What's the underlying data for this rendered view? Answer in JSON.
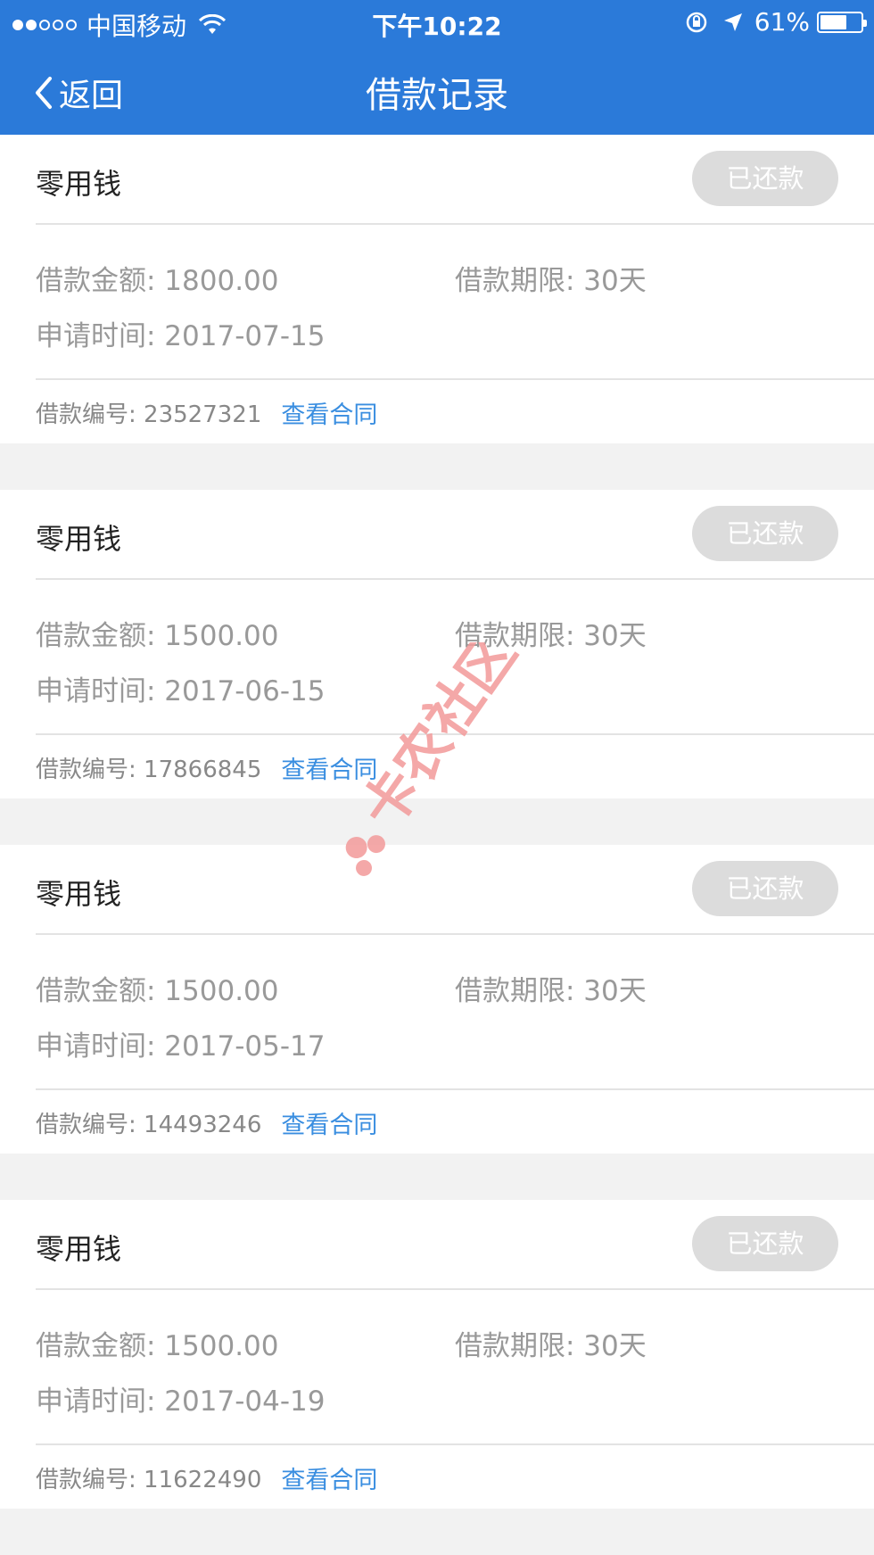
{
  "status_bar": {
    "carrier": "中国移动",
    "time": "下午10:22",
    "battery": "61%",
    "battery_level": 0.61,
    "signal_bars": 2
  },
  "nav": {
    "back_label": "返回",
    "title": "借款记录"
  },
  "colors": {
    "header": "#2b7ad9",
    "link": "#3a8ee0",
    "badge": "#dcdcdc"
  },
  "watermark": "卡农社区",
  "loans": [
    {
      "name": "零用钱",
      "status": "已还款",
      "amount": "借款金额: 1800.00",
      "term": "借款期限: 30天",
      "apply_time": "申请时间: 2017-07-15",
      "number": "借款编号: 23527321",
      "contract_link": "查看合同"
    },
    {
      "name": "零用钱",
      "status": "已还款",
      "amount": "借款金额: 1500.00",
      "term": "借款期限: 30天",
      "apply_time": "申请时间: 2017-06-15",
      "number": "借款编号: 17866845",
      "contract_link": "查看合同"
    },
    {
      "name": "零用钱",
      "status": "已还款",
      "amount": "借款金额: 1500.00",
      "term": "借款期限: 30天",
      "apply_time": "申请时间: 2017-05-17",
      "number": "借款编号: 14493246",
      "contract_link": "查看合同"
    },
    {
      "name": "零用钱",
      "status": "已还款",
      "amount": "借款金额: 1500.00",
      "term": "借款期限: 30天",
      "apply_time": "申请时间: 2017-04-19",
      "number": "借款编号: 11622490",
      "contract_link": "查看合同"
    }
  ]
}
